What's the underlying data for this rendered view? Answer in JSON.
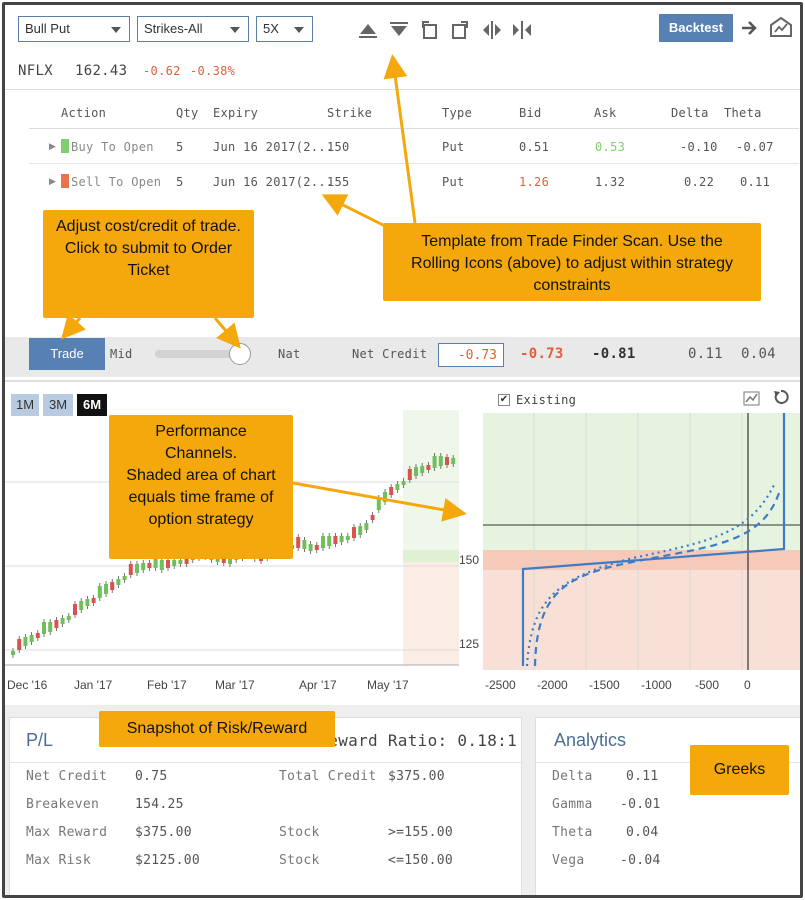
{
  "toolbar": {
    "strategy": "Bull Put",
    "strikes": "Strikes-All",
    "multiplier": "5X",
    "backtest_label": "Backtest"
  },
  "quote": {
    "symbol": "NFLX",
    "price": "162.43",
    "change": "-0.62",
    "change_pct": "-0.38%"
  },
  "legs_table": {
    "headers": [
      "Action",
      "Qty",
      "Expiry",
      "Strike",
      "Type",
      "Bid",
      "Ask",
      "Delta",
      "Theta"
    ],
    "rows": [
      {
        "action": "Buy To Open",
        "qty": "5",
        "expiry": "Jun 16 2017(2...",
        "strike": "150",
        "type": "Put",
        "bid": "0.51",
        "ask": "0.53",
        "delta": "-0.10",
        "theta": "-0.07",
        "marker_color": "#7fcf6e"
      },
      {
        "action": "Sell To Open",
        "qty": "5",
        "expiry": "Jun 16 2017(2...",
        "strike": "155",
        "type": "Put",
        "bid": "1.26",
        "ask": "1.32",
        "delta": "0.22",
        "theta": "0.11",
        "marker_color": "#e9734a"
      }
    ]
  },
  "trade_bar": {
    "trade_label": "Trade",
    "mid_label": "Mid",
    "nat_label": "Nat",
    "net_credit_label": "Net Credit",
    "net_credit_value": "-0.73",
    "value1": "-0.73",
    "value2": "-0.81",
    "value3": "0.11",
    "value4": "0.04",
    "slider_level": 1.0
  },
  "range_buttons": [
    "1M",
    "3M",
    "6M"
  ],
  "existing_label": "Existing",
  "price_chart": {
    "x_ticks": [
      "Dec '16",
      "Jan '17",
      "Feb '17",
      "Mar '17",
      "Apr '17",
      "May '17"
    ],
    "y_ticks": [
      "150",
      "125"
    ]
  },
  "risk_chart": {
    "x_ticks": [
      "-2500",
      "-2000",
      "-1500",
      "-1000",
      "-500",
      "0"
    ]
  },
  "callouts": {
    "adjust": "Adjust cost/credit of trade.\nClick to submit to Order Ticket",
    "template": "Template from Trade Finder Scan.  Use the Rolling Icons (above) to adjust within strategy constraints",
    "performance": "Performance Channels.\nShaded area of chart equals time frame of option strategy",
    "snapshot": "Snapshot of Risk/Reward",
    "greeks": "Greeks"
  },
  "pl_panel": {
    "title": "P/L",
    "reward_ratio": "Reward Ratio: 0.18:1",
    "rows": [
      {
        "label": "Net Credit",
        "value": "0.75",
        "label2": "Total Credit",
        "value2": "$375.00"
      },
      {
        "label": "Breakeven",
        "value": "154.25",
        "label2": "",
        "value2": ""
      },
      {
        "label": "Max Reward",
        "value": "$375.00",
        "label2": "Stock",
        "value2": ">=155.00"
      },
      {
        "label": "Max Risk",
        "value": "$2125.00",
        "label2": "Stock",
        "value2": "<=150.00"
      }
    ]
  },
  "analytics_panel": {
    "title": "Analytics",
    "rows": [
      {
        "label": "Delta",
        "value": "0.11"
      },
      {
        "label": "Gamma",
        "value": "-0.01"
      },
      {
        "label": "Theta",
        "value": "0.04"
      },
      {
        "label": "Vega",
        "value": "-0.04"
      }
    ]
  },
  "colors": {
    "accent_blue": "#5681b2",
    "negative": "#e0603c",
    "positive": "#7fcf6e",
    "callout": "#f5a80c"
  }
}
